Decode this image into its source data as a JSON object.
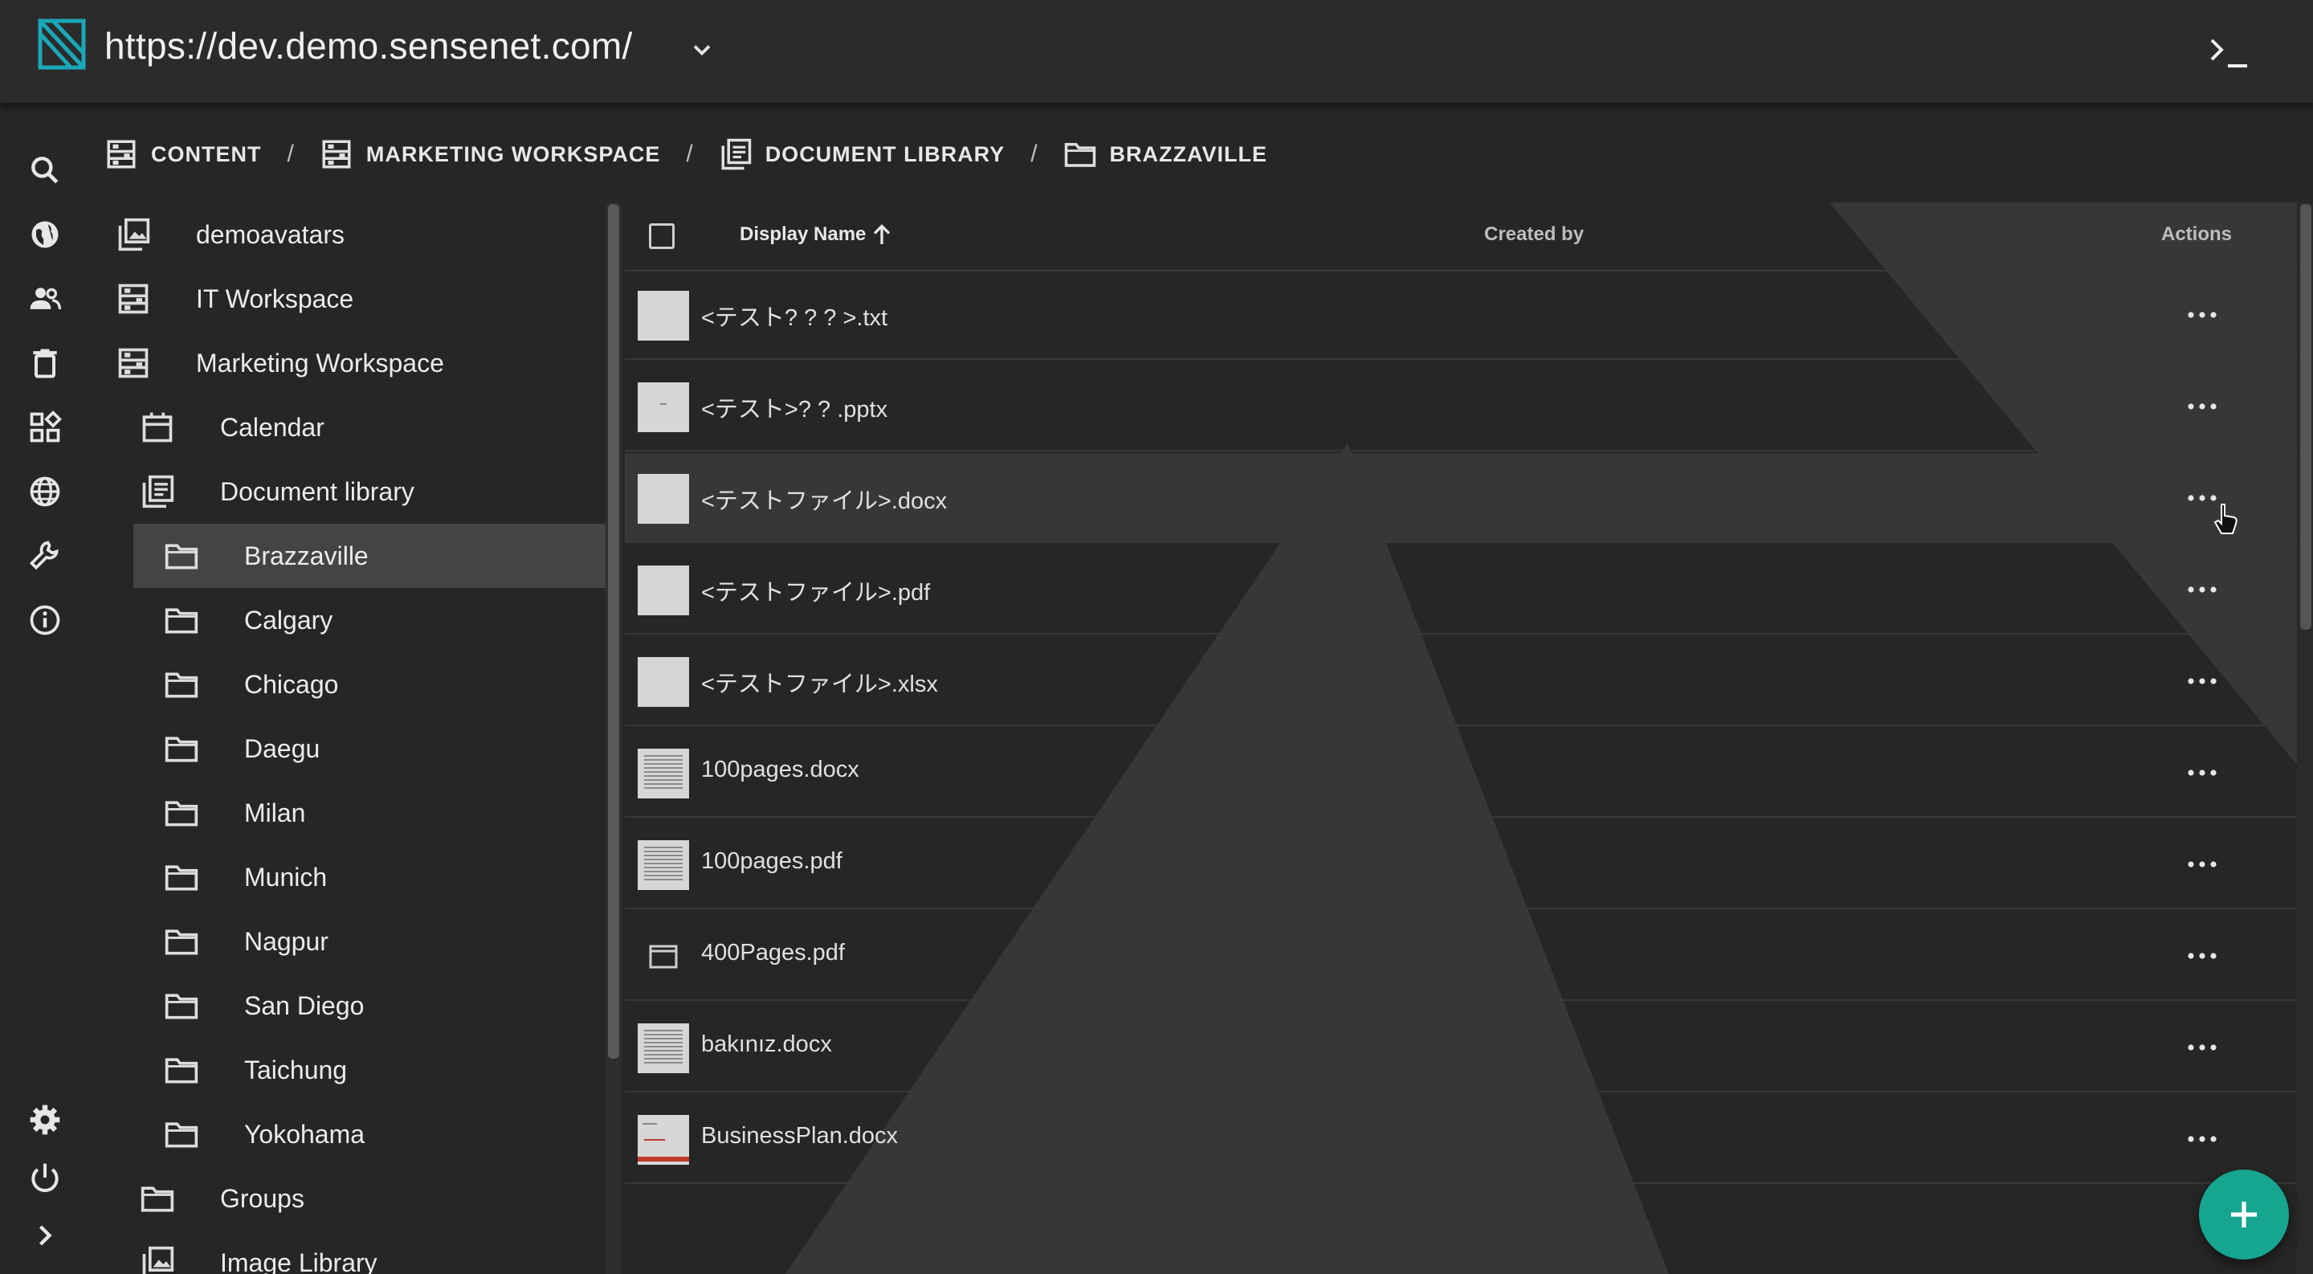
{
  "topbar": {
    "url": "https://dev.demo.sensenet.com/"
  },
  "rail": {
    "icons": [
      "search-icon",
      "globe-icon",
      "users-icon",
      "trash-icon",
      "apps-icon",
      "language-icon",
      "wrench-icon",
      "info-icon",
      "settings-icon",
      "power-icon",
      "expand-icon"
    ]
  },
  "breadcrumb": {
    "items": [
      {
        "label": "CONTENT",
        "icon": "workspace-icon"
      },
      {
        "label": "MARKETING WORKSPACE",
        "icon": "workspace-icon"
      },
      {
        "label": "DOCUMENT LIBRARY",
        "icon": "library-icon"
      },
      {
        "label": "BRAZZAVILLE",
        "icon": "folder-icon"
      }
    ],
    "separator": "/"
  },
  "tree": {
    "items": [
      {
        "label": "demoavatars",
        "icon": "image-library-icon",
        "level": 0
      },
      {
        "label": "IT Workspace",
        "icon": "workspace-icon",
        "level": 0
      },
      {
        "label": "Marketing Workspace",
        "icon": "workspace-icon",
        "level": 0
      },
      {
        "label": "Calendar",
        "icon": "calendar-icon",
        "level": 1
      },
      {
        "label": "Document library",
        "icon": "library-icon",
        "level": 1
      },
      {
        "label": "Brazzaville",
        "icon": "folder-icon",
        "level": 2,
        "selected": true
      },
      {
        "label": "Calgary",
        "icon": "folder-icon",
        "level": 2
      },
      {
        "label": "Chicago",
        "icon": "folder-icon",
        "level": 2
      },
      {
        "label": "Daegu",
        "icon": "folder-icon",
        "level": 2
      },
      {
        "label": "Milan",
        "icon": "folder-icon",
        "level": 2
      },
      {
        "label": "Munich",
        "icon": "folder-icon",
        "level": 2
      },
      {
        "label": "Nagpur",
        "icon": "folder-icon",
        "level": 2
      },
      {
        "label": "San Diego",
        "icon": "folder-icon",
        "level": 2
      },
      {
        "label": "Taichung",
        "icon": "folder-icon",
        "level": 2
      },
      {
        "label": "Yokohama",
        "icon": "folder-icon",
        "level": 2
      },
      {
        "label": "Groups",
        "icon": "folder-icon",
        "level": 1
      },
      {
        "label": "Image Library",
        "icon": "image-library-icon",
        "level": 1
      }
    ]
  },
  "grid": {
    "headers": {
      "display_name": "Display Name",
      "created_by": "Created by",
      "actions": "Actions"
    },
    "sort": "ascending",
    "rows": [
      {
        "name": "<テスト? ? ? >.txt",
        "thumb": "blank"
      },
      {
        "name": "<テスト>? ? .pptx",
        "thumb": "dot"
      },
      {
        "name": "<テストファイル>.docx",
        "thumb": "blank",
        "hover": true
      },
      {
        "name": "<テストファイル>.pdf",
        "thumb": "blank"
      },
      {
        "name": "<テストファイル>.xlsx",
        "thumb": "blank"
      },
      {
        "name": "100pages.docx",
        "thumb": "text"
      },
      {
        "name": "100pages.pdf",
        "thumb": "text"
      },
      {
        "name": "400Pages.pdf",
        "thumb": "file-icon"
      },
      {
        "name": "bakınız.docx",
        "thumb": "text"
      },
      {
        "name": "BusinessPlan.docx",
        "thumb": "plan"
      }
    ]
  },
  "colors": {
    "accent": "#16a58f",
    "background": "#262626",
    "topbar": "#2b2b2b",
    "selected": "#444444"
  }
}
